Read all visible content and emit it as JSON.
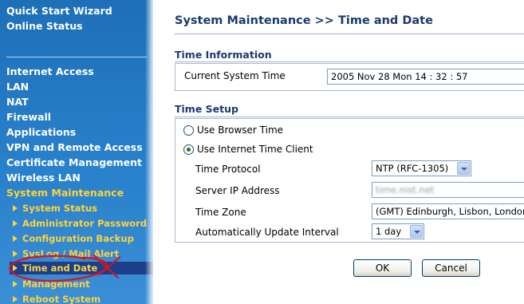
{
  "sidebar": {
    "top_items": [
      "Quick Start Wizard",
      "Online Status"
    ],
    "items": [
      "Internet Access",
      "LAN",
      "NAT",
      "Firewall",
      "Applications",
      "VPN and Remote Access",
      "Certificate Management",
      "Wireless LAN"
    ],
    "active_item": "System Maintenance",
    "sub_items": [
      "System Status",
      "Administrator Password",
      "Configuration Backup",
      "SysLog / Mail Alert",
      "Time and Date",
      "Management",
      "Reboot System"
    ],
    "selected_sub_item": "Time and Date"
  },
  "page": {
    "title": "System Maintenance >> Time and Date"
  },
  "time_info": {
    "heading": "Time Information",
    "current_time_label": "Current System Time",
    "current_time_value": "2005 Nov 28 Mon 14 : 32 : 57"
  },
  "time_setup": {
    "heading": "Time Setup",
    "option_browser": "Use Browser Time",
    "option_internet": "Use Internet Time Client",
    "selected_option": "Use Internet Time Client",
    "protocol_label": "Time Protocol",
    "protocol_value": "NTP (RFC-1305)",
    "server_label": "Server IP Address",
    "server_value": "time.nist.net",
    "zone_label": "Time Zone",
    "zone_value": "(GMT) Edinburgh, Lisbon, London",
    "interval_label": "Automatically Update Interval",
    "interval_value": "1 day"
  },
  "buttons": {
    "ok": "OK",
    "cancel": "Cancel"
  },
  "colors": {
    "sidebar_blue": "#2a82cc",
    "sidebar_highlight": "#ffd23a",
    "heading_navy": "#1b3a6e",
    "annotation_red": "#d0152a"
  }
}
